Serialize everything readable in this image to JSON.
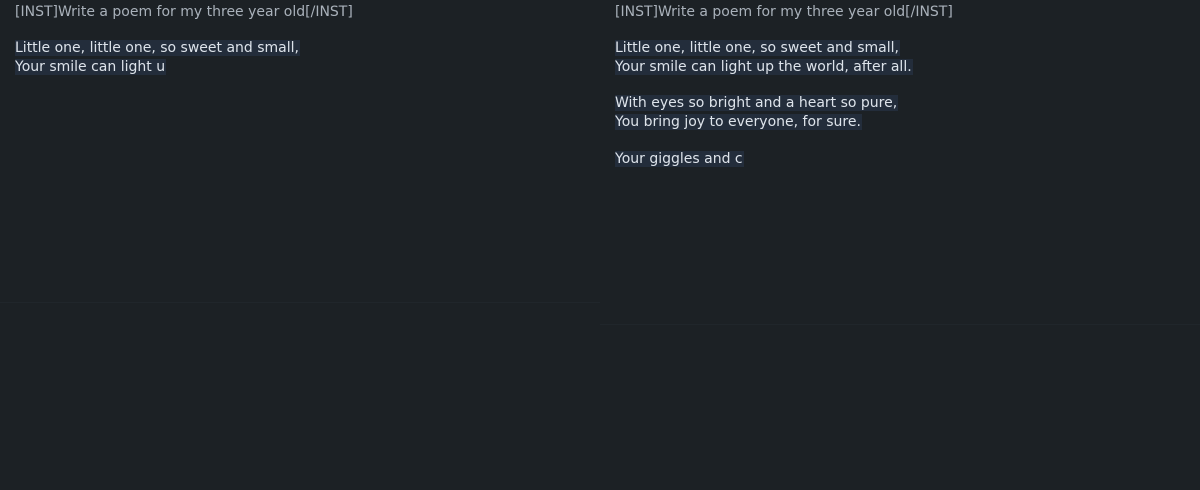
{
  "left_pane": {
    "prompt": "[INST]Write a poem for my three year old[/INST]",
    "stanzas": [
      [
        "Little one, little one, so sweet and small,",
        "Your smile can light u"
      ]
    ]
  },
  "right_pane": {
    "prompt": "[INST]Write a poem for my three year old[/INST]",
    "stanzas": [
      [
        "Little one, little one, so sweet and small,",
        "Your smile can light up the world, after all."
      ],
      [
        "With eyes so bright and a heart so pure,",
        "You bring joy to everyone, for sure."
      ],
      [
        "Your giggles and c"
      ]
    ]
  }
}
